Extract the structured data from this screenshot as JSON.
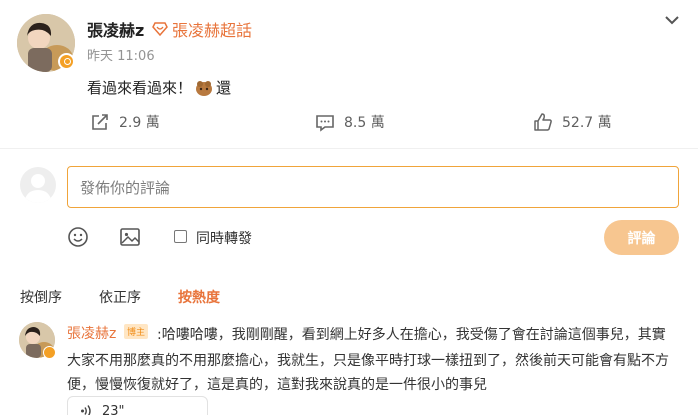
{
  "post": {
    "author": "張凌赫z",
    "topic": "張凌赫超話",
    "time": "昨天 11:06",
    "text_before": "看過來看過來！",
    "text_after": "還",
    "stats": {
      "repost": "2.9 萬",
      "comment": "8.5 萬",
      "like": "52.7 萬"
    }
  },
  "composer": {
    "placeholder": "發佈你的評論",
    "repost_label": "同時轉發",
    "submit_label": "評論"
  },
  "sort": {
    "items": [
      "按倒序",
      "依正序",
      "按熱度"
    ]
  },
  "comment": {
    "author": "張凌赫z",
    "badge": "博主",
    "text": ":哈嘍哈嘍，我剛剛醒，看到網上好多人在擔心，我受傷了會在討論這個事兒，其實",
    "text_cont": "大家不用那麼真的不用那麼擔心，我就生，只是像平時打球一樣扭到了，然後前天可能會有點不方便，慢慢恢復就好了，這是真的，這對我來說真的是一件很小的事兒",
    "voice_duration": "23\""
  },
  "colors": {
    "accent": "#e8743b",
    "verified": "#f4a025",
    "submit_disabled": "#f7c690"
  },
  "icons": [
    "user-avatar",
    "verified-icon",
    "topic-diamond-icon",
    "chevron-down-icon",
    "emoji-in-text",
    "share-icon",
    "comment-icon",
    "like-icon",
    "smiley-icon",
    "image-icon",
    "audio-icon"
  ]
}
